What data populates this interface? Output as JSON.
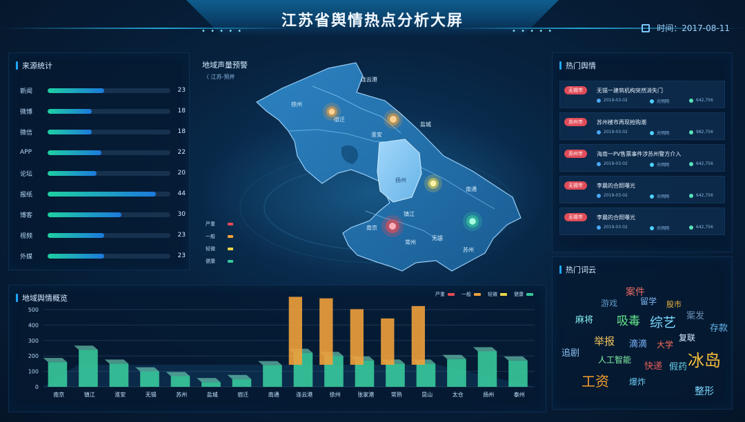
{
  "header": {
    "title": "江苏省舆情热点分析大屏",
    "time_label": "时间：2017-08-11"
  },
  "source_panel": {
    "title": "来源统计",
    "max": 50,
    "items": [
      {
        "label": "新闻",
        "value": 23
      },
      {
        "label": "微博",
        "value": 18
      },
      {
        "label": "微信",
        "value": 18
      },
      {
        "label": "APP",
        "value": 22
      },
      {
        "label": "论坛",
        "value": 20
      },
      {
        "label": "报纸",
        "value": 44
      },
      {
        "label": "博客",
        "value": 30
      },
      {
        "label": "视频",
        "value": 23
      },
      {
        "label": "外媒",
        "value": 23
      }
    ]
  },
  "map": {
    "title": "地域声量预警",
    "sub": "〈 江苏-预并",
    "cities": [
      {
        "name": "连云港"
      },
      {
        "name": "徐州"
      },
      {
        "name": "宿迁"
      },
      {
        "name": "淮安"
      },
      {
        "name": "盐城"
      },
      {
        "name": "扬州"
      },
      {
        "name": "南通"
      },
      {
        "name": "镇江"
      },
      {
        "name": "南京"
      },
      {
        "name": "常州"
      },
      {
        "name": "无锡"
      },
      {
        "name": "苏州"
      }
    ],
    "legend": [
      {
        "label": "严重",
        "color": "#e84a55"
      },
      {
        "label": "一般",
        "color": "#f0a13b"
      },
      {
        "label": "轻微",
        "color": "#f0d54a"
      },
      {
        "label": "健康",
        "color": "#37c99b"
      }
    ],
    "alerts": [
      {
        "city": "宿迁",
        "level": "一般"
      },
      {
        "city": "淮安",
        "level": "一般"
      },
      {
        "city": "扬州",
        "level": "轻微"
      },
      {
        "city": "南京",
        "level": "严重"
      },
      {
        "city": "南通",
        "level": "健康"
      }
    ]
  },
  "hot_panel": {
    "title": "热门舆情",
    "items": [
      {
        "badge": "无锡市",
        "title": "无锡一建筑机构突然消失门",
        "date": "2019-03-02",
        "source": "光明网",
        "count": "642,756"
      },
      {
        "badge": "苏州市",
        "title": "苏州楼市再现抢购潮",
        "date": "2019-03-02",
        "source": "光明网",
        "count": "982,756"
      },
      {
        "badge": "苏州市",
        "title": "海南一PV售票事件涉苏州警方介入",
        "date": "2019-03-02",
        "source": "光明网",
        "count": "642,756"
      },
      {
        "badge": "无锡市",
        "title": "李晨的合照曝光",
        "date": "2019-03-02",
        "source": "光明网",
        "count": "642,756"
      },
      {
        "badge": "无锡市",
        "title": "李晨的合照曝光",
        "date": "2019-03-02",
        "source": "光明网",
        "count": "642,756"
      }
    ]
  },
  "cloud_panel": {
    "title": "热门词云",
    "words": [
      {
        "text": "案件",
        "color": "#e86a63",
        "size": 14
      },
      {
        "text": "游戏",
        "color": "#5f98c8",
        "size": 12
      },
      {
        "text": "留学",
        "color": "#7fb7f5",
        "size": 12
      },
      {
        "text": "股市",
        "color": "#f0b640",
        "size": 11
      },
      {
        "text": "麻将",
        "color": "#86f0f1",
        "size": 13
      },
      {
        "text": "吸毒",
        "color": "#67e88f",
        "size": 17
      },
      {
        "text": "综艺",
        "color": "#7dd9ff",
        "size": 19
      },
      {
        "text": "案发",
        "color": "#6b8fb4",
        "size": 13
      },
      {
        "text": "存款",
        "color": "#66b8ef",
        "size": 13
      },
      {
        "text": "举报",
        "color": "#f0c05a",
        "size": 15
      },
      {
        "text": "滴滴",
        "color": "#7eb6ff",
        "size": 13
      },
      {
        "text": "大学",
        "color": "#ff6f57",
        "size": 12
      },
      {
        "text": "复联",
        "color": "#d7f0ff",
        "size": 12
      },
      {
        "text": "追剧",
        "color": "#8dc1f2",
        "size": 13
      },
      {
        "text": "人工智能",
        "color": "#85f3a8",
        "size": 12
      },
      {
        "text": "快递",
        "color": "#e95e59",
        "size": 13
      },
      {
        "text": "假药",
        "color": "#67cfe6",
        "size": 13
      },
      {
        "text": "冰岛",
        "color": "#f6be3b",
        "size": 24
      },
      {
        "text": "工资",
        "color": "#f59d2c",
        "size": 20
      },
      {
        "text": "爆炸",
        "color": "#6cc8ef",
        "size": 12
      },
      {
        "text": "整形",
        "color": "#7bd8ff",
        "size": 14
      }
    ]
  },
  "bar_panel": {
    "title": "地域舆情概览",
    "legend": [
      {
        "label": "严重",
        "color": "#e84a55"
      },
      {
        "label": "一般",
        "color": "#f0a13b"
      },
      {
        "label": "轻微",
        "color": "#f0d54a"
      },
      {
        "label": "健康",
        "color": "#37c99b"
      }
    ]
  },
  "chart_data": {
    "type": "bar",
    "title": "地域舆情概览",
    "categories": [
      "南京",
      "镇江",
      "淮安",
      "无锡",
      "苏州",
      "盐城",
      "宿迁",
      "南通",
      "连云港",
      "徐州",
      "张家港",
      "常熟",
      "昆山",
      "太仓",
      "扬州",
      "泰州"
    ],
    "ylim": [
      0,
      500
    ],
    "yticks": [
      0,
      100,
      200,
      300,
      400,
      500
    ],
    "series": [
      {
        "name": "严重",
        "color": "#e84a55",
        "values": [
          0,
          0,
          0,
          0,
          0,
          0,
          0,
          0,
          0,
          0,
          0,
          0,
          0,
          0,
          0,
          0
        ]
      },
      {
        "name": "一般",
        "color": "#f0a13b",
        "values": [
          0,
          0,
          0,
          0,
          0,
          0,
          0,
          0,
          440,
          430,
          360,
          300,
          380,
          0,
          0,
          0
        ]
      },
      {
        "name": "轻微",
        "color": "#f0d54a",
        "values": [
          0,
          0,
          0,
          0,
          0,
          0,
          0,
          0,
          0,
          0,
          0,
          0,
          0,
          0,
          0,
          0
        ]
      },
      {
        "name": "健康",
        "color": "#37c99b",
        "values": [
          160,
          240,
          150,
          100,
          70,
          30,
          50,
          140,
          220,
          200,
          170,
          150,
          150,
          180,
          230,
          170
        ]
      }
    ]
  }
}
